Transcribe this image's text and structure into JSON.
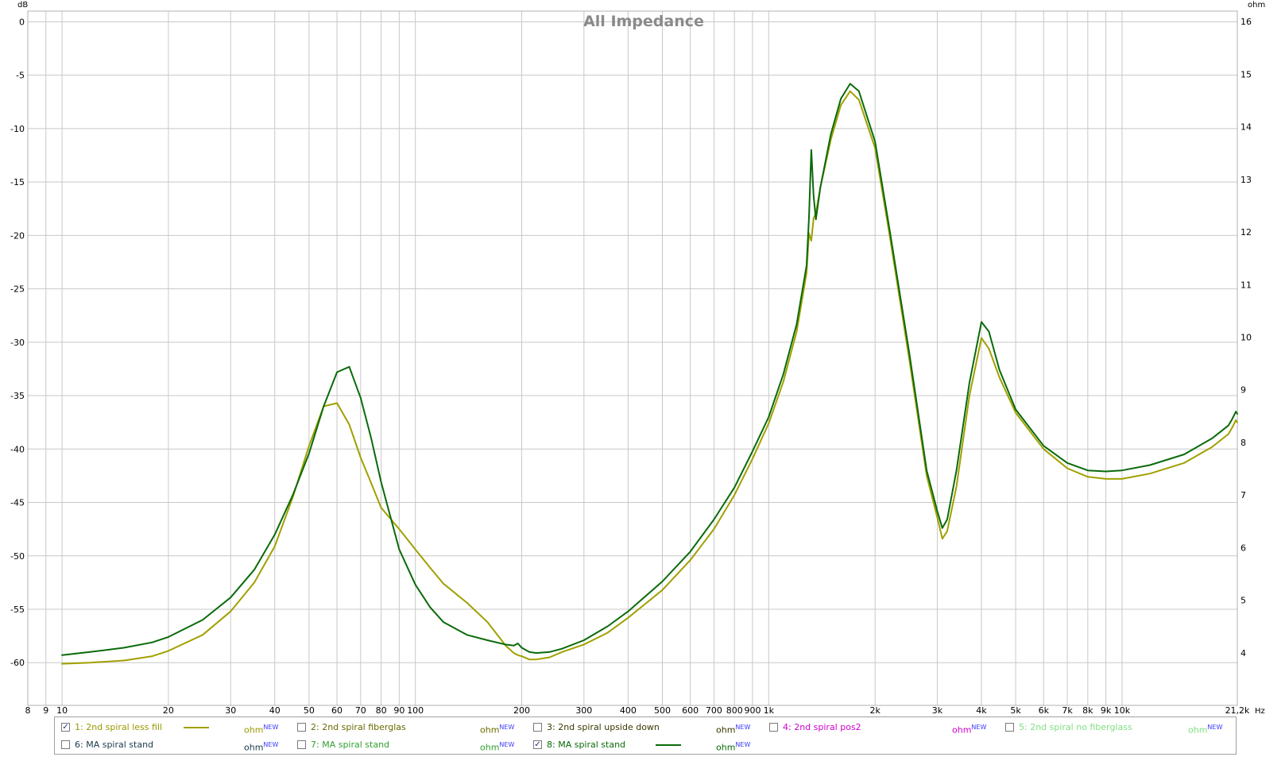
{
  "chart_data": {
    "type": "line",
    "title": "All Impedance",
    "left_axis_unit": "dB",
    "right_axis_unit": "ohm",
    "x_scale": "log",
    "x_unit": "Hz",
    "xlim": [
      8,
      21200
    ],
    "ylim_left": [
      -64,
      1
    ],
    "ylim_right": [
      3,
      16.2
    ],
    "grid": true,
    "x_ticks": [
      {
        "v": 8,
        "label": "8"
      },
      {
        "v": 9,
        "label": "9"
      },
      {
        "v": 10,
        "label": "10"
      },
      {
        "v": 20,
        "label": "20"
      },
      {
        "v": 30,
        "label": "30"
      },
      {
        "v": 40,
        "label": "40"
      },
      {
        "v": 50,
        "label": "50"
      },
      {
        "v": 60,
        "label": "60"
      },
      {
        "v": 70,
        "label": "70"
      },
      {
        "v": 80,
        "label": "80"
      },
      {
        "v": 90,
        "label": "90"
      },
      {
        "v": 100,
        "label": "100"
      },
      {
        "v": 200,
        "label": "200"
      },
      {
        "v": 300,
        "label": "300"
      },
      {
        "v": 400,
        "label": "400"
      },
      {
        "v": 500,
        "label": "500"
      },
      {
        "v": 600,
        "label": "600"
      },
      {
        "v": 700,
        "label": "700"
      },
      {
        "v": 800,
        "label": "800"
      },
      {
        "v": 900,
        "label": "900"
      },
      {
        "v": 1000,
        "label": "1k"
      },
      {
        "v": 2000,
        "label": "2k"
      },
      {
        "v": 3000,
        "label": "3k"
      },
      {
        "v": 4000,
        "label": "4k"
      },
      {
        "v": 5000,
        "label": "5k"
      },
      {
        "v": 6000,
        "label": "6k"
      },
      {
        "v": 7000,
        "label": "7k"
      },
      {
        "v": 8000,
        "label": "8k"
      },
      {
        "v": 9000,
        "label": "9k"
      },
      {
        "v": 10000,
        "label": "10k"
      },
      {
        "v": 21200,
        "label": "21,2k"
      }
    ],
    "y_left_ticks": [
      0,
      -5,
      -10,
      -15,
      -20,
      -25,
      -30,
      -35,
      -40,
      -45,
      -50,
      -55,
      -60
    ],
    "y_right_ticks": [
      16,
      15,
      14,
      13,
      12,
      11,
      10,
      9,
      8,
      7,
      6,
      5,
      4
    ],
    "series": [
      {
        "name": "1: 2nd spiral less fill",
        "color": "#a0a000",
        "x": [
          10,
          12,
          15,
          18,
          20,
          25,
          30,
          35,
          40,
          45,
          50,
          55,
          60,
          65,
          70,
          75,
          80,
          90,
          100,
          110,
          120,
          140,
          160,
          180,
          190,
          195,
          200,
          210,
          220,
          240,
          260,
          300,
          350,
          400,
          500,
          600,
          700,
          800,
          900,
          1000,
          1100,
          1200,
          1280,
          1300,
          1320,
          1340,
          1360,
          1400,
          1500,
          1600,
          1700,
          1800,
          2000,
          2200,
          2500,
          2800,
          3000,
          3100,
          3200,
          3400,
          3700,
          4000,
          4200,
          4500,
          5000,
          6000,
          7000,
          8000,
          9000,
          10000,
          12000,
          15000,
          18000,
          20000,
          20500,
          21000,
          21200
        ],
        "y": [
          -60.1,
          -60.0,
          -59.8,
          -59.4,
          -58.9,
          -57.4,
          -55.2,
          -52.5,
          -49.1,
          -44.5,
          -39.7,
          -36.0,
          -35.7,
          -37.7,
          -40.8,
          -43.2,
          -45.5,
          -47.5,
          -49.4,
          -51.1,
          -52.6,
          -54.4,
          -56.2,
          -58.4,
          -59.1,
          -59.3,
          -59.4,
          -59.7,
          -59.7,
          -59.5,
          -59.0,
          -58.3,
          -57.2,
          -55.8,
          -53.2,
          -50.4,
          -47.5,
          -44.3,
          -40.9,
          -37.6,
          -33.7,
          -29.0,
          -23.5,
          -19.8,
          -20.5,
          -18.4,
          -17.9,
          -15.5,
          -11.0,
          -7.8,
          -6.5,
          -7.3,
          -11.8,
          -20.0,
          -31.6,
          -42.5,
          -46.4,
          -48.4,
          -47.7,
          -43.5,
          -35.0,
          -29.6,
          -30.6,
          -33.3,
          -36.6,
          -40.0,
          -41.8,
          -42.6,
          -42.8,
          -42.8,
          -42.3,
          -41.3,
          -39.8,
          -38.6,
          -38.0,
          -37.3,
          -37.5
        ]
      },
      {
        "name": "8: MA spiral stand",
        "color": "#0a6a0a",
        "x": [
          10,
          12,
          15,
          18,
          20,
          25,
          30,
          35,
          40,
          45,
          50,
          55,
          60,
          65,
          70,
          75,
          80,
          90,
          100,
          110,
          120,
          140,
          160,
          180,
          190,
          195,
          200,
          210,
          220,
          240,
          260,
          300,
          350,
          400,
          500,
          600,
          700,
          800,
          900,
          1000,
          1100,
          1200,
          1280,
          1300,
          1320,
          1340,
          1360,
          1400,
          1500,
          1600,
          1700,
          1800,
          2000,
          2200,
          2500,
          2800,
          3000,
          3100,
          3200,
          3400,
          3700,
          4000,
          4200,
          4500,
          5000,
          6000,
          7000,
          8000,
          9000,
          10000,
          12000,
          15000,
          18000,
          20000,
          20500,
          21000,
          21200
        ],
        "y": [
          -59.3,
          -59.0,
          -58.6,
          -58.1,
          -57.6,
          -56.0,
          -53.9,
          -51.3,
          -48.0,
          -44.3,
          -40.4,
          -36.0,
          -32.8,
          -32.3,
          -35.2,
          -39.0,
          -43.1,
          -49.4,
          -52.7,
          -54.8,
          -56.2,
          -57.4,
          -57.9,
          -58.3,
          -58.4,
          -58.2,
          -58.6,
          -59.0,
          -59.1,
          -59.0,
          -58.7,
          -57.9,
          -56.6,
          -55.2,
          -52.4,
          -49.6,
          -46.6,
          -43.6,
          -40.2,
          -37.0,
          -33.0,
          -28.3,
          -22.8,
          -18.3,
          -12.0,
          -16.3,
          -18.5,
          -15.5,
          -10.5,
          -7.2,
          -5.8,
          -6.5,
          -11.2,
          -19.5,
          -31.0,
          -42.0,
          -45.8,
          -47.4,
          -46.6,
          -42.0,
          -33.8,
          -28.1,
          -29.0,
          -32.6,
          -36.3,
          -39.7,
          -41.3,
          -42.0,
          -42.1,
          -42.0,
          -41.5,
          -40.5,
          -39.0,
          -37.8,
          -37.2,
          -36.5,
          -36.7
        ]
      }
    ]
  },
  "legend": {
    "new_badge": "NEW",
    "items": [
      {
        "label": "1: 2nd spiral less fill",
        "unit": "ohm",
        "checked": true,
        "color": "#9a9a00",
        "swatch": "#a0a000"
      },
      {
        "label": "2: 2nd spiral fiberglas",
        "unit": "ohm",
        "checked": false,
        "color": "#6a6a00",
        "swatch": ""
      },
      {
        "label": "3: 2nd spiral upside down",
        "unit": "ohm",
        "checked": false,
        "color": "#3a3a00",
        "swatch": ""
      },
      {
        "label": "4: 2nd spiral pos2",
        "unit": "ohm",
        "checked": false,
        "color": "#d000d0",
        "swatch": ""
      },
      {
        "label": "5: 2nd spiral no fiberglass",
        "unit": "ohm",
        "checked": false,
        "color": "#80e080",
        "swatch": ""
      },
      {
        "label": "6: MA spiral stand",
        "unit": "ohm",
        "checked": false,
        "color": "#1a3a4a",
        "swatch": ""
      },
      {
        "label": "7: MA spiral stand",
        "unit": "ohm",
        "checked": false,
        "color": "#30a030",
        "swatch": ""
      },
      {
        "label": "8: MA spiral stand",
        "unit": "ohm",
        "checked": true,
        "color": "#0a6a0a",
        "swatch": "#0a6a0a"
      }
    ]
  }
}
